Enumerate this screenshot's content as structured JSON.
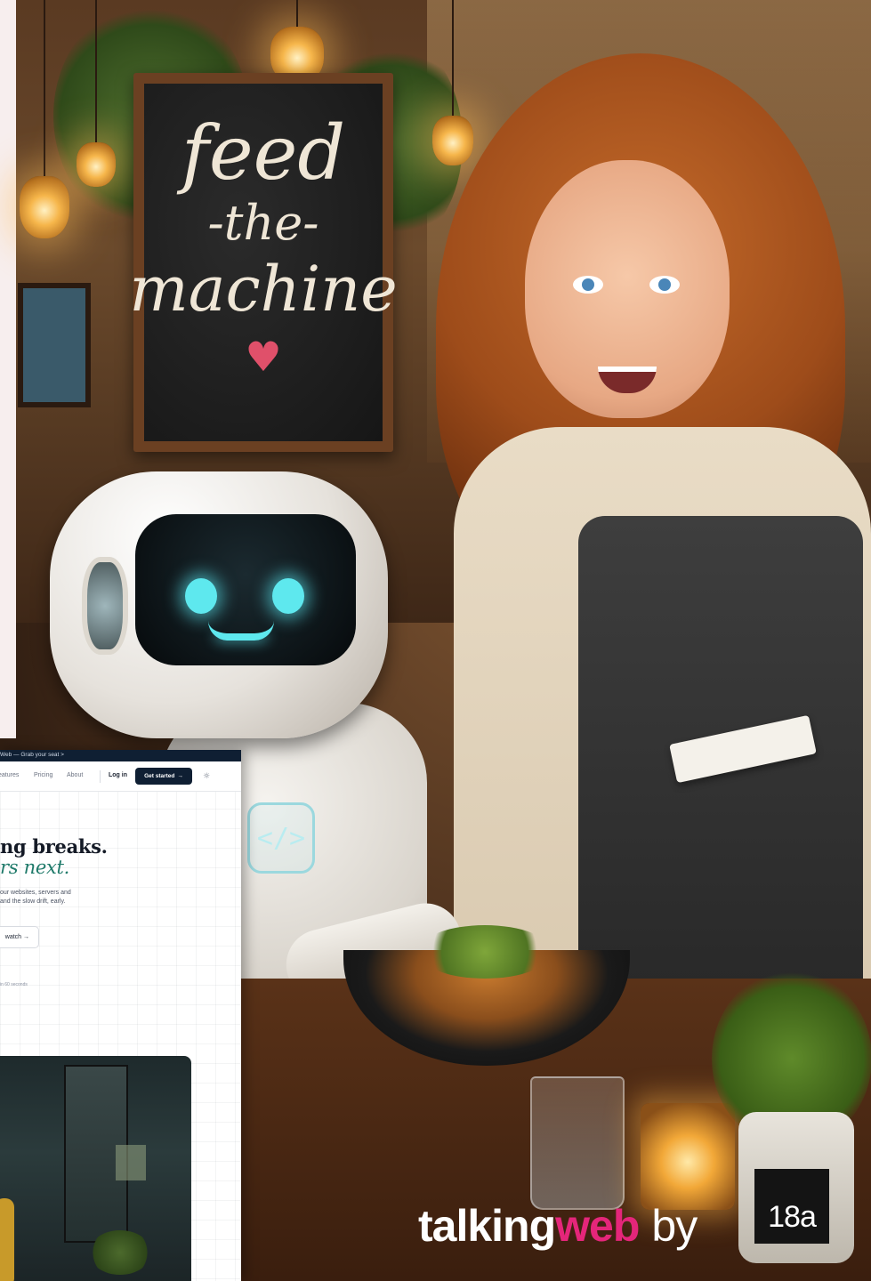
{
  "scene": {
    "chalkboard": {
      "line1": "feed",
      "line2": "-the-",
      "line3": "machine",
      "heart": "♥"
    },
    "robot_chest_code": "</>"
  },
  "website": {
    "announcement": "Web — Grab your seat >",
    "nav": {
      "items": [
        "eatures",
        "Pricing",
        "About"
      ],
      "login": "Log in",
      "cta": "Get started",
      "cta_arrow": "→",
      "theme_icon": "☼"
    },
    "hero": {
      "headline_line1": "ng breaks.",
      "headline_line2": "rs next.",
      "sub_line1": "our websites, servers and",
      "sub_line2": "and the slow drift, early.",
      "secondary_button": "watch →",
      "tiny_note": "in 60 seconds"
    }
  },
  "branding": {
    "word1": "talking",
    "word2": "web",
    "word3": "by",
    "logo": "18a",
    "accent_color": "#e4267a",
    "site_dark": "#0f1f33",
    "site_green": "#1f7a6a"
  }
}
